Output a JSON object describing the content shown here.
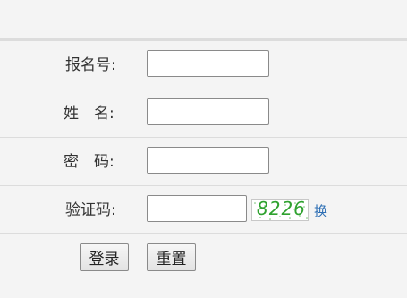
{
  "form": {
    "fields": [
      {
        "label": "报名号:",
        "value": "",
        "type": "text"
      },
      {
        "label": "姓　名:",
        "value": "",
        "type": "text"
      },
      {
        "label": "密　码:",
        "value": "",
        "type": "password"
      },
      {
        "label": "验证码:",
        "value": "",
        "type": "text"
      }
    ],
    "captcha": {
      "code": "8226",
      "refresh_label": "换",
      "color": "#2fa22f"
    },
    "buttons": {
      "login_label": "登录",
      "reset_label": "重置"
    }
  },
  "colors": {
    "background": "#f4f4f4",
    "divider": "#dcdcdc",
    "link": "#2e6fb4"
  }
}
